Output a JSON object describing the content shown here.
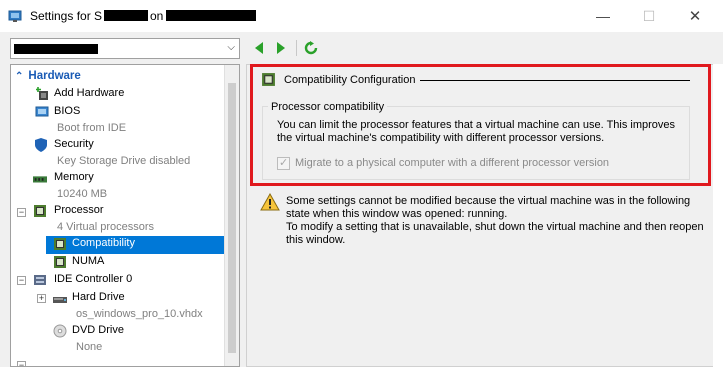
{
  "window": {
    "title_prefix": "Settings for S",
    "title_mid": "on"
  },
  "title_controls": {
    "minimize": "—",
    "maximize": "☐",
    "close": "✕"
  },
  "vm_selector": {
    "arrow": "⌵"
  },
  "tree": {
    "section": "Hardware",
    "items": [
      {
        "label": "Add Hardware",
        "sub": ""
      },
      {
        "label": "BIOS",
        "sub": "Boot from IDE"
      },
      {
        "label": "Security",
        "sub": "Key Storage Drive disabled"
      },
      {
        "label": "Memory",
        "sub": "10240 MB"
      },
      {
        "label": "Processor",
        "sub": "4 Virtual processors"
      },
      {
        "label": "Compatibility",
        "sub": ""
      },
      {
        "label": "NUMA",
        "sub": ""
      },
      {
        "label": "IDE Controller 0",
        "sub": ""
      },
      {
        "label": "Hard Drive",
        "sub": "os_windows_pro_10.vhdx"
      },
      {
        "label": "DVD Drive",
        "sub": "None"
      }
    ]
  },
  "content": {
    "section_title": "Compatibility Configuration",
    "group_label": "Processor compatibility",
    "description": "You can limit the processor features that a virtual machine can use. This improves the virtual machine's compatibility with different processor versions.",
    "checkbox_label": "Migrate to a physical computer with a different processor version",
    "checkbox_checked": true,
    "warning_line1": "Some settings cannot be modified because the virtual machine was in the following state when this window was opened: running.",
    "warning_line2": "To modify a setting that is unavailable, shut down the virtual machine and then reopen this window."
  },
  "colors": {
    "selection": "#0078d7",
    "highlight_frame": "#e0191e",
    "section_head": "#1a5bb5",
    "nav_green": "#2aa12a"
  }
}
